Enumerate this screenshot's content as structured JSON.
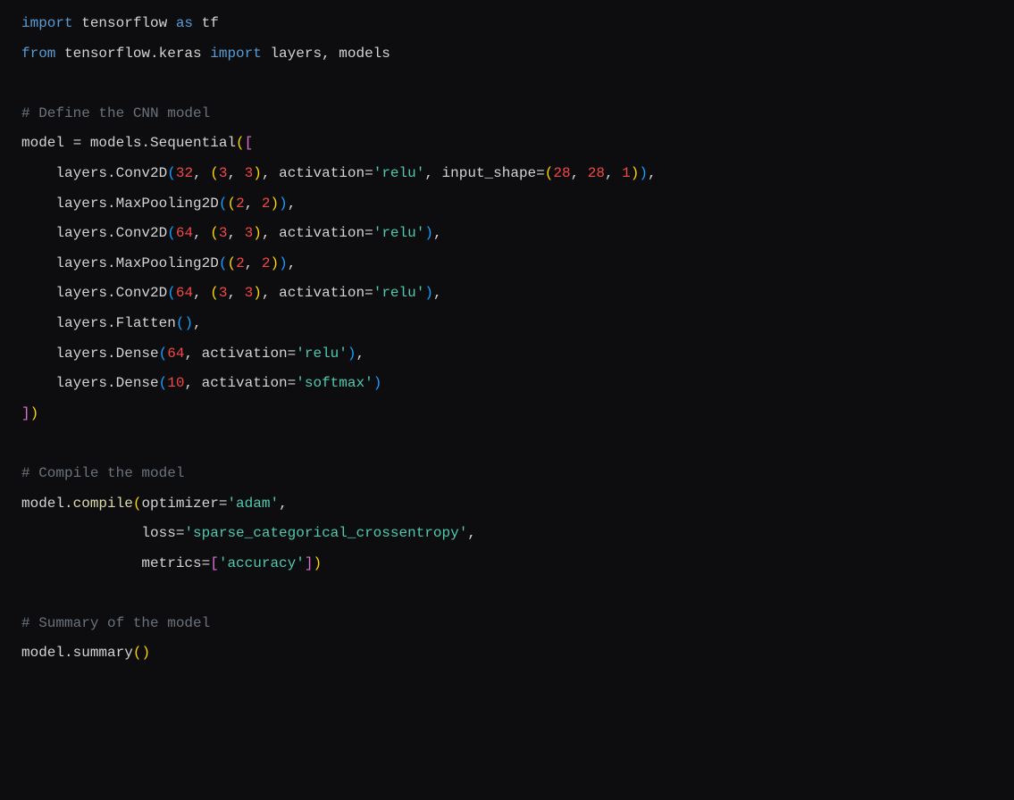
{
  "code": {
    "line1": {
      "kw_import": "import",
      "mod": " tensorflow ",
      "kw_as": "as",
      "alias": " tf"
    },
    "line2": {
      "kw_from": "from",
      "mod": " tensorflow.keras ",
      "kw_import": "import",
      "names": " layers, models"
    },
    "comment1": "# Define the CNN model",
    "line4_a": "model = models.Sequential",
    "line4_paren_open": "(",
    "line4_bracket_open": "[",
    "line5_a": "    layers.Conv2D",
    "line5_po": "(",
    "line5_n1": "32",
    "line5_c1": ", ",
    "line5_tpo": "(",
    "line5_n2": "3",
    "line5_c2": ", ",
    "line5_n3": "3",
    "line5_tpc": ")",
    "line5_c3": ", activation=",
    "line5_s1": "'relu'",
    "line5_c4": ", input_shape=",
    "line5_ispo": "(",
    "line5_n4": "28",
    "line5_c5": ", ",
    "line5_n5": "28",
    "line5_c6": ", ",
    "line5_n6": "1",
    "line5_ispc": ")",
    "line5_pc": ")",
    "line5_end": ",",
    "line6_a": "    layers.MaxPooling2D",
    "line6_po": "(",
    "line6_tpo": "(",
    "line6_n1": "2",
    "line6_c1": ", ",
    "line6_n2": "2",
    "line6_tpc": ")",
    "line6_pc": ")",
    "line6_end": ",",
    "line7_a": "    layers.Conv2D",
    "line7_po": "(",
    "line7_n1": "64",
    "line7_c1": ", ",
    "line7_tpo": "(",
    "line7_n2": "3",
    "line7_c2": ", ",
    "line7_n3": "3",
    "line7_tpc": ")",
    "line7_c3": ", activation=",
    "line7_s1": "'relu'",
    "line7_pc": ")",
    "line7_end": ",",
    "line8_a": "    layers.MaxPooling2D",
    "line8_po": "(",
    "line8_tpo": "(",
    "line8_n1": "2",
    "line8_c1": ", ",
    "line8_n2": "2",
    "line8_tpc": ")",
    "line8_pc": ")",
    "line8_end": ",",
    "line9_a": "    layers.Conv2D",
    "line9_po": "(",
    "line9_n1": "64",
    "line9_c1": ", ",
    "line9_tpo": "(",
    "line9_n2": "3",
    "line9_c2": ", ",
    "line9_n3": "3",
    "line9_tpc": ")",
    "line9_c3": ", activation=",
    "line9_s1": "'relu'",
    "line9_pc": ")",
    "line9_end": ",",
    "line10_a": "    layers.Flatten",
    "line10_po": "(",
    "line10_pc": ")",
    "line10_end": ",",
    "line11_a": "    layers.Dense",
    "line11_po": "(",
    "line11_n1": "64",
    "line11_c1": ", activation=",
    "line11_s1": "'relu'",
    "line11_pc": ")",
    "line11_end": ",",
    "line12_a": "    layers.Dense",
    "line12_po": "(",
    "line12_n1": "10",
    "line12_c1": ", activation=",
    "line12_s1": "'softmax'",
    "line12_pc": ")",
    "line13_bracket_close": "]",
    "line13_paren_close": ")",
    "comment2": "# Compile the model",
    "line15_a": "model.",
    "line15_fn": "compile",
    "line15_po": "(",
    "line15_arg1": "optimizer=",
    "line15_s1": "'adam'",
    "line15_c1": ",",
    "line16_pad": "              loss=",
    "line16_s1": "'sparse_categorical_crossentropy'",
    "line16_c1": ",",
    "line17_pad": "              metrics=",
    "line17_bo": "[",
    "line17_s1": "'accuracy'",
    "line17_bc": "]",
    "line17_pc": ")",
    "comment3": "# Summary of the model",
    "line19_a": "model.summary",
    "line19_po": "(",
    "line19_pc": ")"
  }
}
